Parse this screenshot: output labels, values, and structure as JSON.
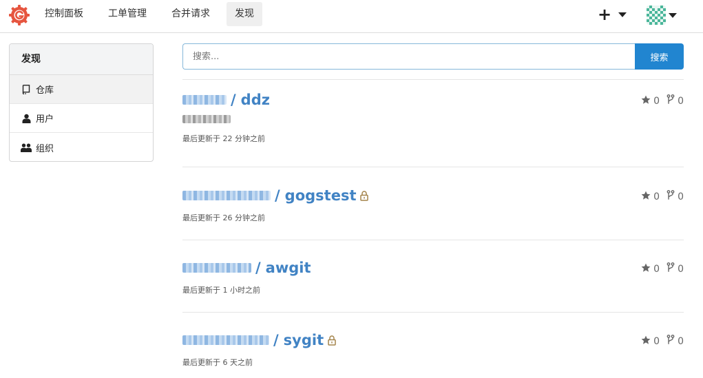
{
  "header": {
    "nav": [
      {
        "label": "控制面板",
        "active": false
      },
      {
        "label": "工单管理",
        "active": false
      },
      {
        "label": "合并请求",
        "active": false
      },
      {
        "label": "发现",
        "active": true
      }
    ],
    "plus_label": "+",
    "logo_color": "#e6553f"
  },
  "sidebar": {
    "title": "发现",
    "items": [
      {
        "label": "仓库",
        "icon": "repo-icon",
        "active": true
      },
      {
        "label": "用户",
        "icon": "user-icon",
        "active": false
      },
      {
        "label": "组织",
        "icon": "organization-icon",
        "active": false
      }
    ]
  },
  "search": {
    "placeholder": "搜索...",
    "value": "",
    "button_label": "搜索"
  },
  "repos": [
    {
      "owner": "",
      "slash": "/",
      "name": "ddz",
      "private": false,
      "has_description": true,
      "updated": "最后更新于 22 分钟之前",
      "stars": "0",
      "forks": "0"
    },
    {
      "owner": "",
      "slash": "/",
      "name": "gogstest",
      "private": true,
      "has_description": false,
      "updated": "最后更新于 26 分钟之前",
      "stars": "0",
      "forks": "0"
    },
    {
      "owner": "",
      "slash": "/",
      "name": "awgit",
      "private": false,
      "has_description": false,
      "updated": "最后更新于 1 小时之前",
      "stars": "0",
      "forks": "0"
    },
    {
      "owner": "",
      "slash": "/",
      "name": "sygit",
      "private": true,
      "has_description": false,
      "updated": "最后更新于 6 天之前",
      "stars": "0",
      "forks": "0"
    }
  ],
  "colors": {
    "link": "#4183c4",
    "primary_button": "#2185d0",
    "lock": "#a3834a"
  }
}
